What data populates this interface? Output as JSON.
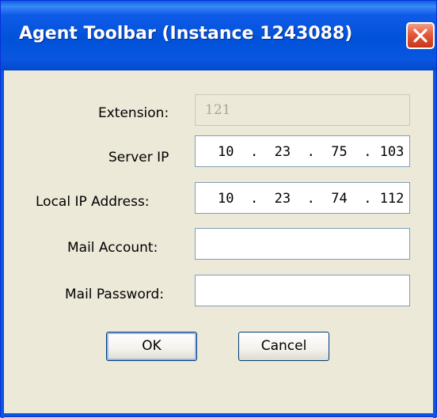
{
  "window": {
    "title": "Agent Toolbar (Instance 1243088)"
  },
  "form": {
    "extension": {
      "label": "Extension:",
      "value": "121"
    },
    "server_ip": {
      "label": "Server IP",
      "value": "10  .  23  .  75  . 103"
    },
    "local_ip": {
      "label": "Local IP Address:",
      "value": "10  .  23  .  74  . 112"
    },
    "mail_account": {
      "label": "Mail Account:",
      "value": ""
    },
    "mail_password": {
      "label": "Mail Password:",
      "value": ""
    }
  },
  "buttons": {
    "ok": "OK",
    "cancel": "Cancel"
  },
  "icons": {
    "close": "close-icon"
  },
  "colors": {
    "titlebar": "#0052d9",
    "close": "#e4593a",
    "face": "#ece9d8"
  }
}
